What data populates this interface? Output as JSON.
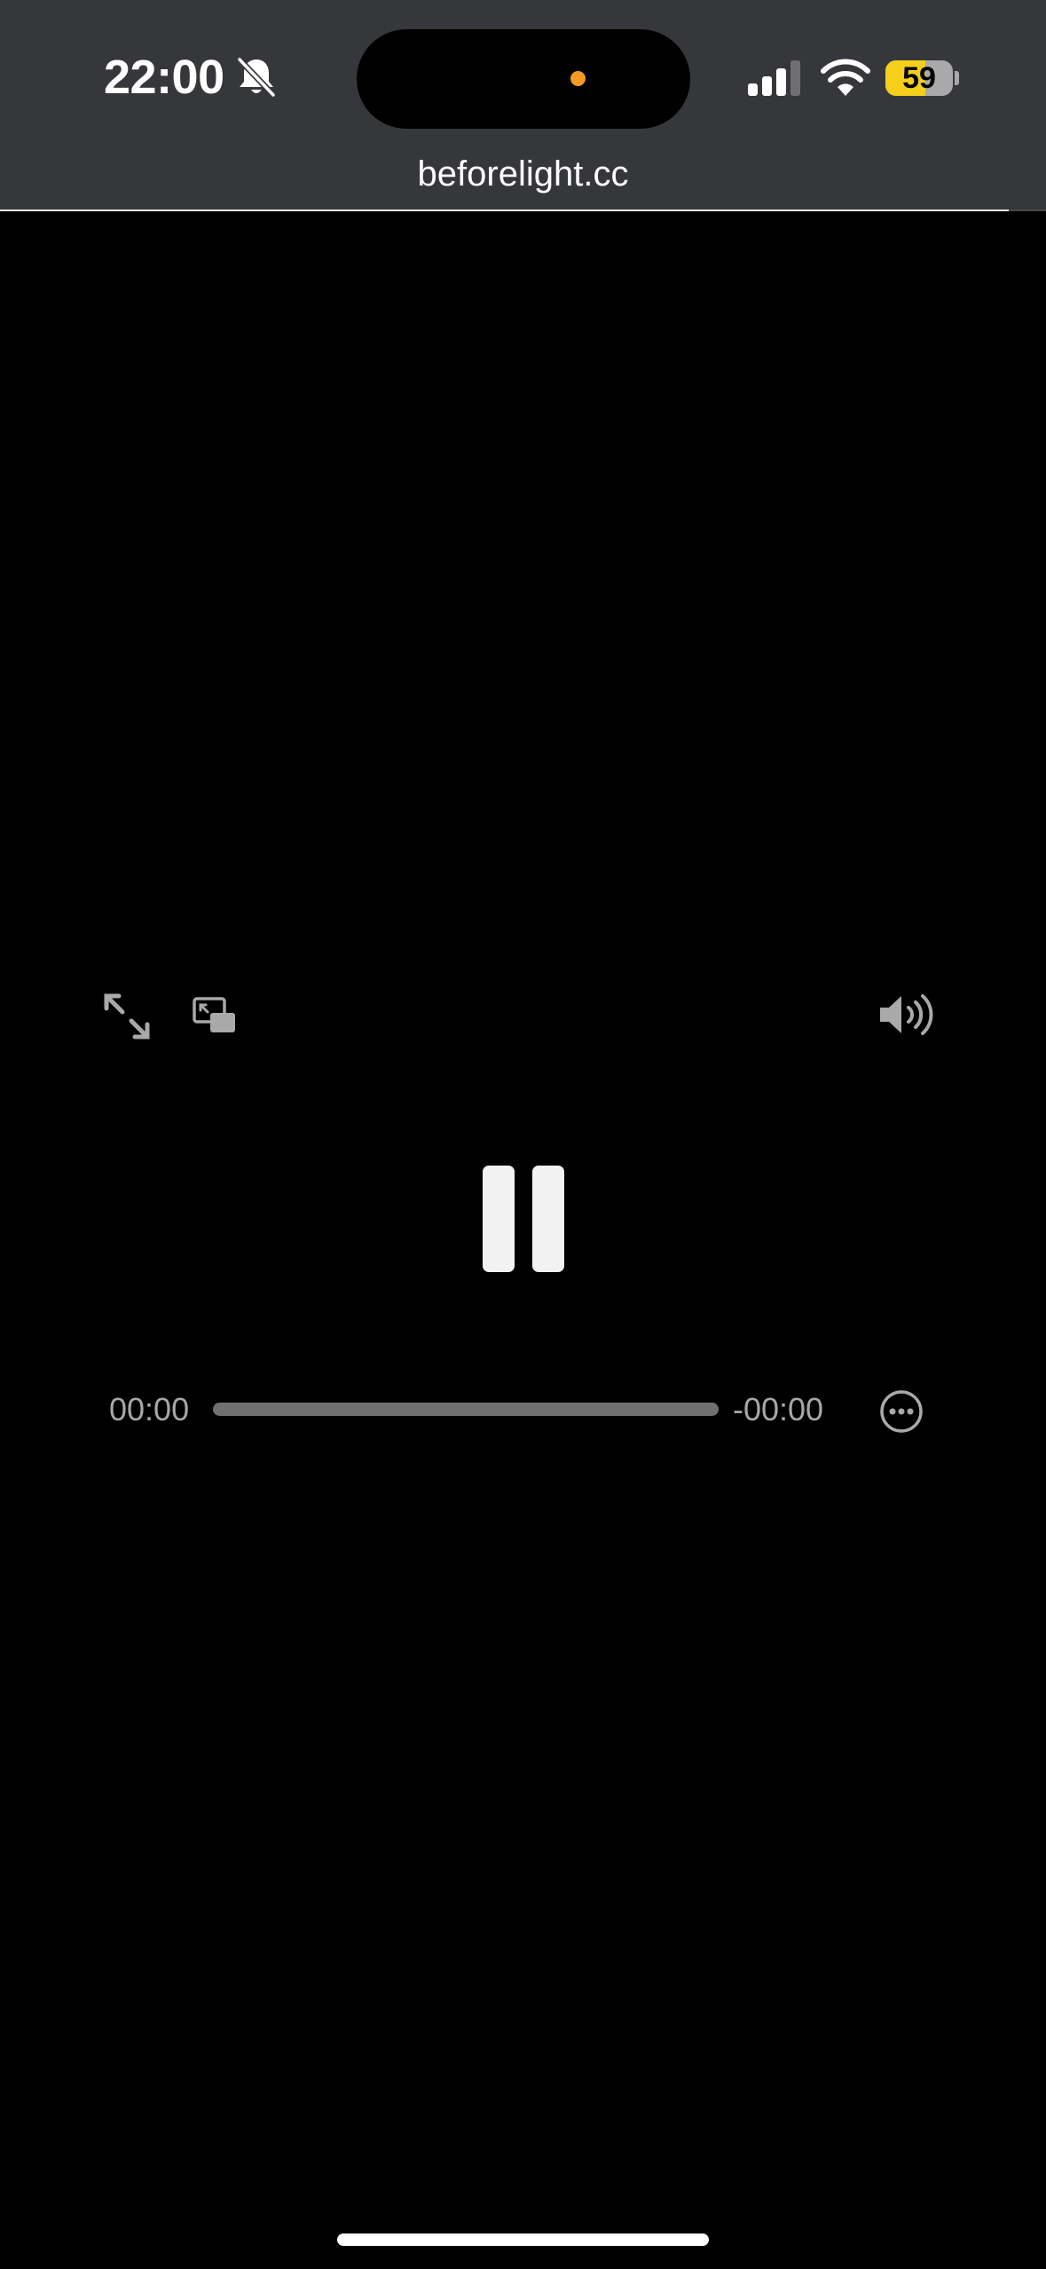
{
  "status_bar": {
    "time": "22:00",
    "battery_level": "59",
    "battery_percent": 59,
    "battery_color": "#f5cf1c",
    "icons": [
      "bell-slash-icon",
      "cellular-signal-icon",
      "wifi-icon",
      "battery-icon"
    ]
  },
  "browser": {
    "url": "beforelight.cc"
  },
  "player": {
    "current_time": "00:00",
    "remaining_time": "-00:00",
    "progress": 0,
    "state": "playing",
    "controls": [
      "fullscreen-icon",
      "picture-in-picture-icon",
      "volume-icon",
      "pause-icon",
      "more-options-icon"
    ]
  }
}
